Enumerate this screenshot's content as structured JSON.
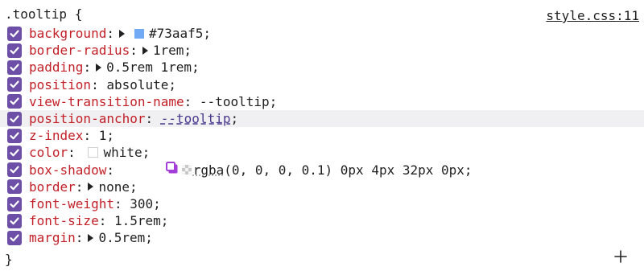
{
  "rule": {
    "selector_open": ".tooltip {",
    "closing_brace": "}",
    "source": "style.css:11",
    "add_icon": "plus-icon",
    "checkbox_icon": "checkmark-icon",
    "declarations": [
      {
        "prop": "background",
        "value": "#73aaf5",
        "swatch": "#73aaf5",
        "expand": true
      },
      {
        "prop": "border-radius",
        "value": "1rem",
        "expand": true
      },
      {
        "prop": "padding",
        "value": "0.5rem 1rem",
        "expand": true
      },
      {
        "prop": "position",
        "value": "absolute"
      },
      {
        "prop": "view-transition-name",
        "value": "--tooltip"
      },
      {
        "prop": "position-anchor",
        "value": "--tooltip",
        "link": true,
        "highlight": true
      },
      {
        "prop": "z-index",
        "value": "1"
      },
      {
        "prop": "color",
        "value": "white",
        "swatch": "#ffffff"
      },
      {
        "prop": "box-shadow",
        "value_prefix": "rgba",
        "value": "(0, 0, 0, 0.1) 0px 4px 32px 0px",
        "shadow_editor": true
      },
      {
        "prop": "border",
        "value": "none",
        "expand": true
      },
      {
        "prop": "font-weight",
        "value": "300"
      },
      {
        "prop": "font-size",
        "value": "1.5rem"
      },
      {
        "prop": "margin",
        "value": "0.5rem",
        "expand": true
      }
    ]
  },
  "colors": {
    "checkbox": "#6d4fa7",
    "property": "#c21f27",
    "link": "#4b3a8e",
    "highlight_row": "#f0f0f2",
    "shadow_icon": "#a53ed8"
  }
}
